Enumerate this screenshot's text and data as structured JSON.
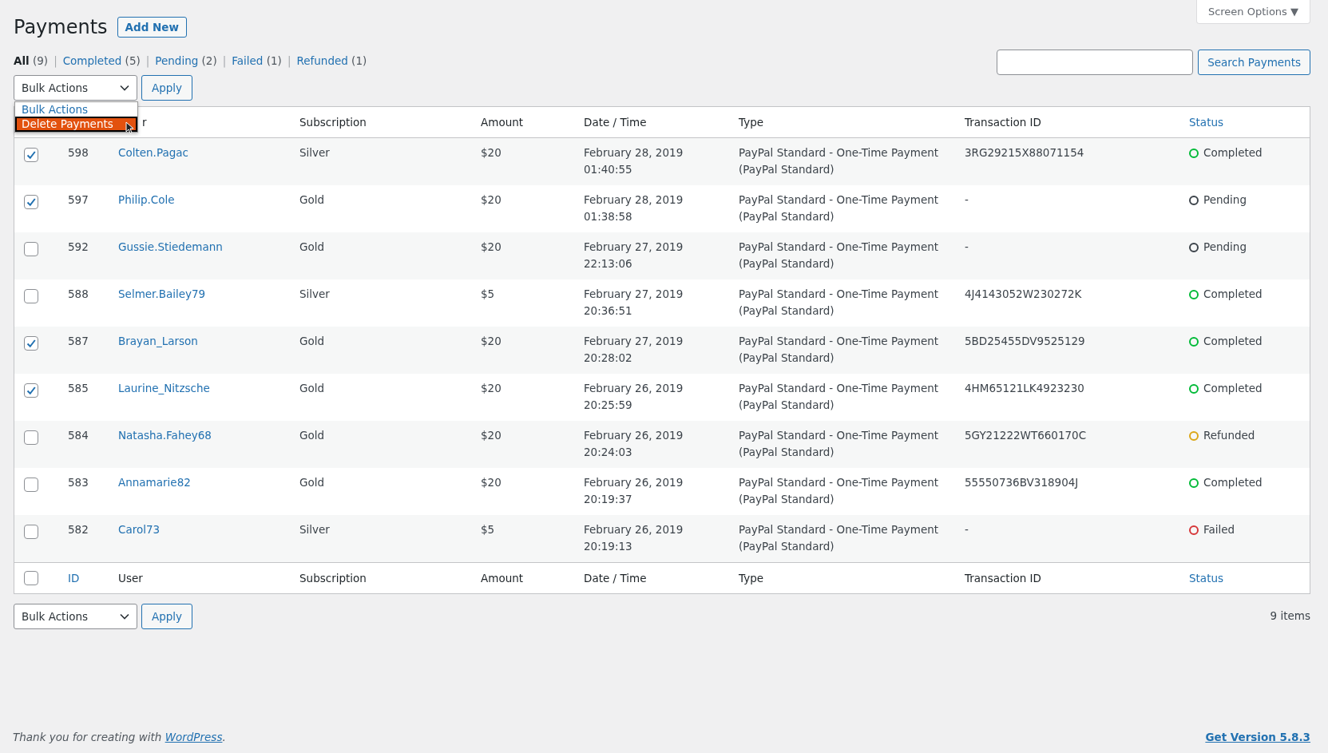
{
  "page_title": "Payments",
  "add_new": "Add New",
  "screen_options": "Screen Options ▼",
  "filters": [
    {
      "label": "All",
      "count": "(9)",
      "selected": true
    },
    {
      "separator": "|",
      "label": "Completed",
      "count": "(5)",
      "selected": false
    },
    {
      "separator": "|",
      "label": "Pending",
      "count": "(2)",
      "selected": false
    },
    {
      "separator": "|",
      "label": "Failed",
      "count": "(1)",
      "selected": false
    },
    {
      "separator": "|",
      "label": "Refunded",
      "count": "(1)",
      "selected": false
    }
  ],
  "search_button": "Search Payments",
  "top_actions": {
    "select": "Bulk Actions",
    "apply": "Apply",
    "menu": [
      {
        "label": "Bulk Actions",
        "selected": false
      },
      {
        "label": "Delete Payments",
        "selected": true
      }
    ]
  },
  "header_columns": [
    {
      "label": "r",
      "sortable": false
    },
    {
      "label": "Subscription",
      "sortable": false
    },
    {
      "label": "Amount",
      "sortable": false
    },
    {
      "label": "Date / Time",
      "sortable": false
    },
    {
      "label": "Type",
      "sortable": false
    },
    {
      "label": "Transaction ID",
      "sortable": false
    },
    {
      "label": "Status",
      "sortable": true
    }
  ],
  "rows": [
    {
      "checked": true,
      "id": "598",
      "user": "Colten.Pagac",
      "subscription": "Silver",
      "amount": "$20",
      "date": "February 28, 2019",
      "time": "01:40:55",
      "type": "PayPal Standard - One-Time Payment",
      "gateway": "(PayPal Standard)",
      "transaction_id": "3RG29215X88071154",
      "status": "Completed",
      "color": "#00ba37"
    },
    {
      "checked": true,
      "id": "597",
      "user": "Philip.Cole",
      "subscription": "Gold",
      "amount": "$20",
      "date": "February 28, 2019",
      "time": "01:38:58",
      "type": "PayPal Standard - One-Time Payment",
      "gateway": "(PayPal Standard)",
      "transaction_id": "-",
      "status": "Pending",
      "color": "#3c434a"
    },
    {
      "checked": false,
      "id": "592",
      "user": "Gussie.Stiedemann",
      "subscription": "Gold",
      "amount": "$20",
      "date": "February 27, 2019",
      "time": "22:13:06",
      "type": "PayPal Standard - One-Time Payment",
      "gateway": "(PayPal Standard)",
      "transaction_id": "-",
      "status": "Pending",
      "color": "#3c434a"
    },
    {
      "checked": false,
      "id": "588",
      "user": "Selmer.Bailey79",
      "subscription": "Silver",
      "amount": "$5",
      "date": "February 27, 2019",
      "time": "20:36:51",
      "type": "PayPal Standard - One-Time Payment",
      "gateway": "(PayPal Standard)",
      "transaction_id": "4J4143052W230272K",
      "status": "Completed",
      "color": "#00ba37"
    },
    {
      "checked": true,
      "id": "587",
      "user": "Brayan_Larson",
      "subscription": "Gold",
      "amount": "$20",
      "date": "February 27, 2019",
      "time": "20:28:02",
      "type": "PayPal Standard - One-Time Payment",
      "gateway": "(PayPal Standard)",
      "transaction_id": "5BD25455DV9525129",
      "status": "Completed",
      "color": "#00ba37"
    },
    {
      "checked": true,
      "id": "585",
      "user": "Laurine_Nitzsche",
      "subscription": "Gold",
      "amount": "$20",
      "date": "February 26, 2019",
      "time": "20:25:59",
      "type": "PayPal Standard - One-Time Payment",
      "gateway": "(PayPal Standard)",
      "transaction_id": "4HM65121LK4923230",
      "status": "Completed",
      "color": "#00ba37"
    },
    {
      "checked": false,
      "id": "584",
      "user": "Natasha.Fahey68",
      "subscription": "Gold",
      "amount": "$20",
      "date": "February 26, 2019",
      "time": "20:24:03",
      "type": "PayPal Standard - One-Time Payment",
      "gateway": "(PayPal Standard)",
      "transaction_id": "5GY21222WT660170C",
      "status": "Refunded",
      "color": "#dba617"
    },
    {
      "checked": false,
      "id": "583",
      "user": "Annamarie82",
      "subscription": "Gold",
      "amount": "$20",
      "date": "February 26, 2019",
      "time": "20:19:37",
      "type": "PayPal Standard - One-Time Payment",
      "gateway": "(PayPal Standard)",
      "transaction_id": "55550736BV318904J",
      "status": "Completed",
      "color": "#00ba37"
    },
    {
      "checked": false,
      "id": "582",
      "user": "Carol73",
      "subscription": "Silver",
      "amount": "$5",
      "date": "February 26, 2019",
      "time": "20:19:13",
      "type": "PayPal Standard - One-Time Payment",
      "gateway": "(PayPal Standard)",
      "transaction_id": "-",
      "status": "Failed",
      "color": "#d63638"
    }
  ],
  "footer_columns": [
    {
      "label": "ID",
      "sortable": true
    },
    {
      "label": "User",
      "sortable": false
    },
    {
      "label": "Subscription",
      "sortable": false
    },
    {
      "label": "Amount",
      "sortable": false
    },
    {
      "label": "Date / Time",
      "sortable": false
    },
    {
      "label": "Type",
      "sortable": false
    },
    {
      "label": "Transaction ID",
      "sortable": false
    },
    {
      "label": "Status",
      "sortable": true
    }
  ],
  "footer_select_all": {
    "checked": false
  },
  "bottom_actions": {
    "select": "Bulk Actions",
    "apply": "Apply"
  },
  "item_count": "9 items",
  "footer_text": "Thank you for creating with",
  "footer_link": "WordPress",
  "footer_period": ".",
  "version_link": "Get Version 5.8.3"
}
